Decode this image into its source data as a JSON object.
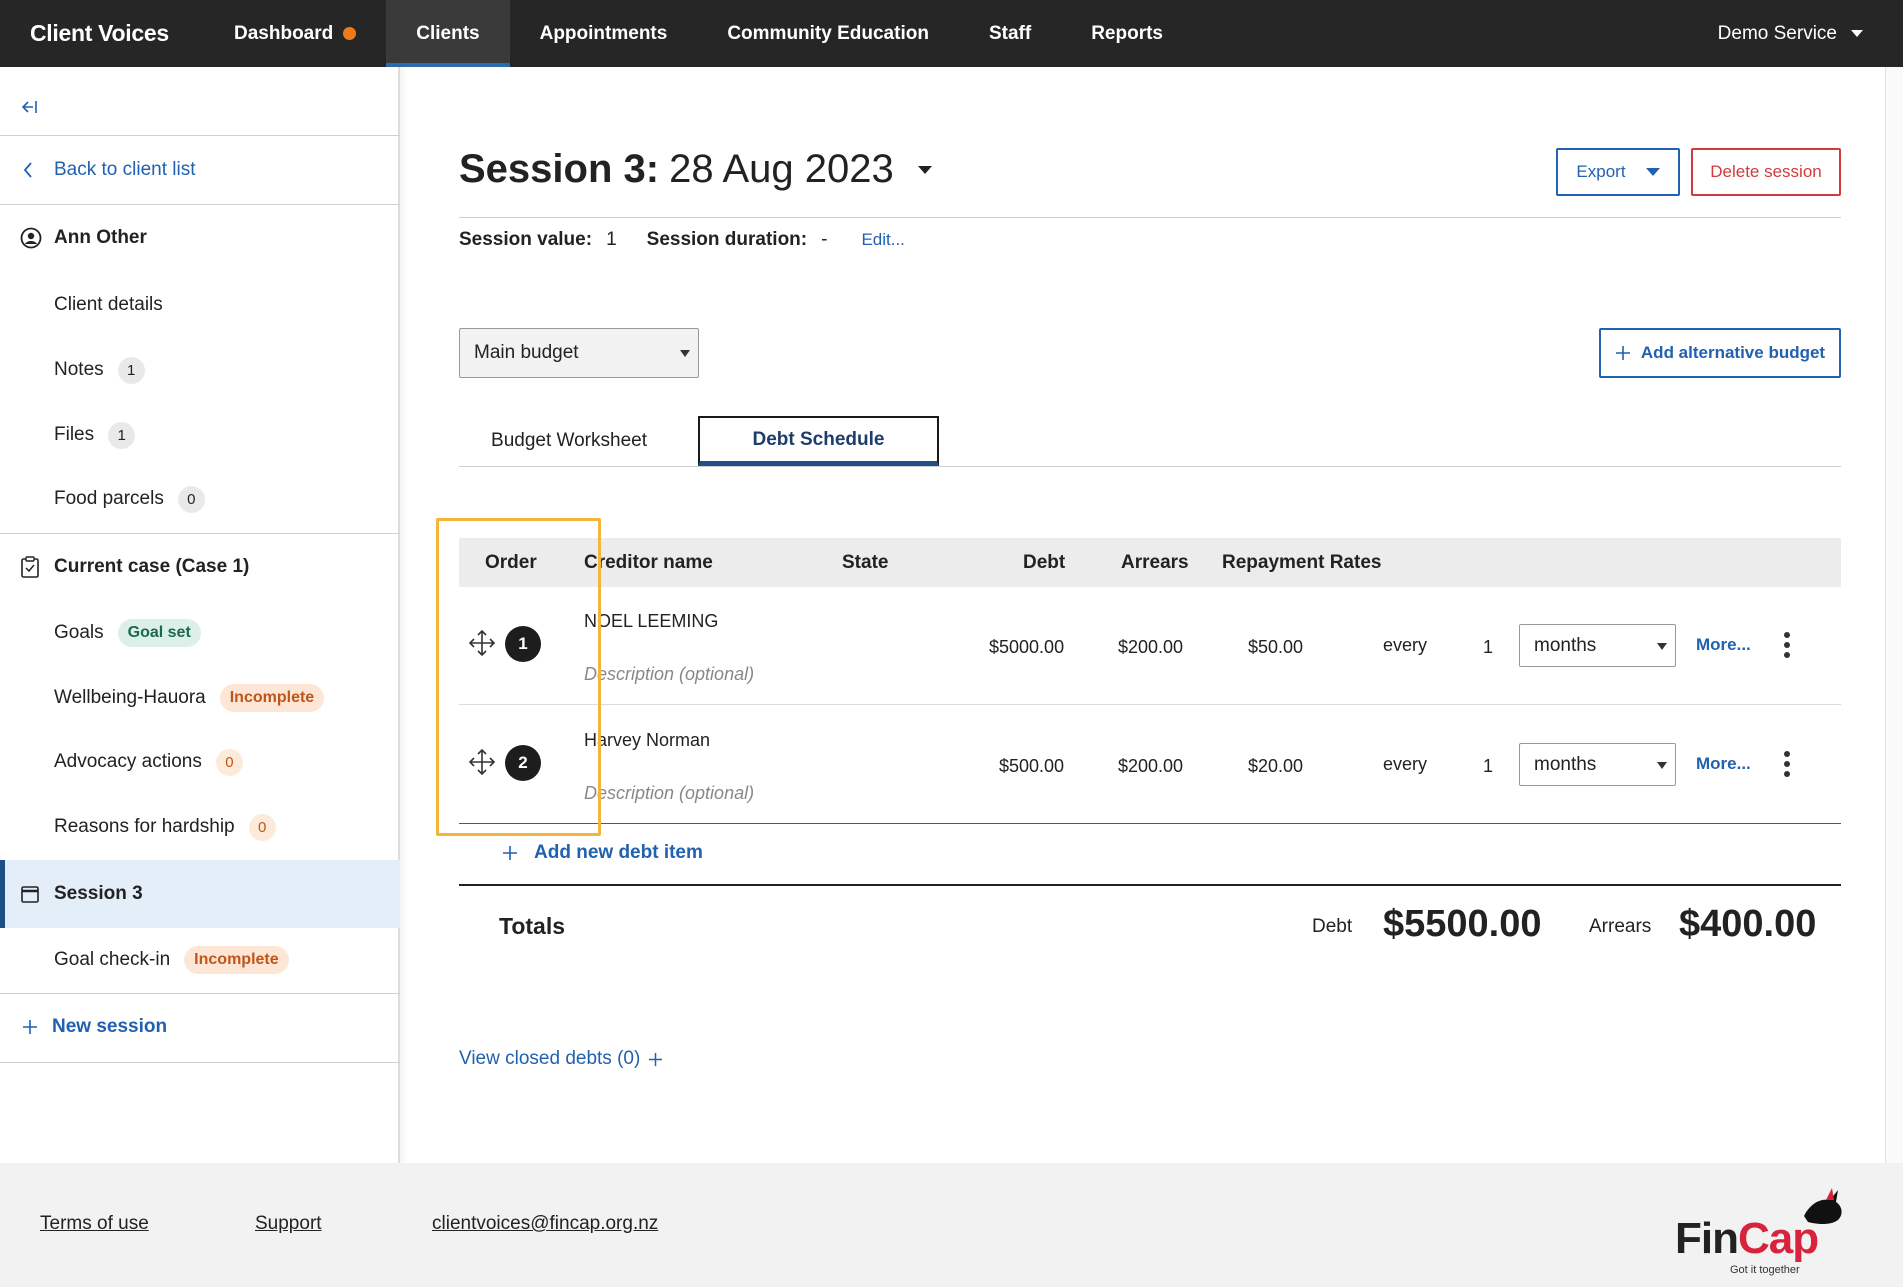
{
  "app": {
    "brand": "Client Voices"
  },
  "nav": {
    "dashboard": "Dashboard",
    "clients": "Clients",
    "appointments": "Appointments",
    "community_education": "Community Education",
    "staff": "Staff",
    "reports": "Reports",
    "service": "Demo Service"
  },
  "sidebar": {
    "back": "Back to client list",
    "client_name": "Ann Other",
    "client_details": "Client details",
    "notes": "Notes",
    "notes_count": "1",
    "files": "Files",
    "files_count": "1",
    "food_parcels": "Food parcels",
    "food_parcels_count": "0",
    "current_case": "Current case (Case 1)",
    "goals": "Goals",
    "goals_badge": "Goal set",
    "wellbeing": "Wellbeing-Hauora",
    "wellbeing_badge": "Incomplete",
    "advocacy": "Advocacy actions",
    "advocacy_count": "0",
    "hardship": "Reasons for hardship",
    "hardship_count": "0",
    "session": "Session 3",
    "goal_checkin": "Goal check-in",
    "goal_checkin_badge": "Incomplete",
    "new_session": "New session"
  },
  "session": {
    "title_prefix": "Session 3:",
    "title_date": "28 Aug 2023",
    "export": "Export",
    "delete": "Delete session",
    "value_label": "Session value:",
    "value": "1",
    "duration_label": "Session duration:",
    "duration": "-",
    "edit": "Edit..."
  },
  "budget": {
    "selected": "Main budget",
    "add_alternative": "Add alternative budget",
    "tabs": [
      "Budget Worksheet",
      "Debt Schedule"
    ],
    "active_tab": "Debt Schedule"
  },
  "table": {
    "headers": {
      "order": "Order",
      "creditor": "Creditor name",
      "state": "State",
      "debt": "Debt",
      "arrears": "Arrears",
      "repayment": "Repayment Rates"
    },
    "rows": [
      {
        "order": "1",
        "creditor": "NOEL LEEMING",
        "description_placeholder": "Description (optional)",
        "debt": "$5000.00",
        "arrears": "$200.00",
        "rate": "$50.00",
        "every": "every",
        "qty": "1",
        "period": "months",
        "more": "More..."
      },
      {
        "order": "2",
        "creditor": "Harvey Norman",
        "description_placeholder": "Description (optional)",
        "debt": "$500.00",
        "arrears": "$200.00",
        "rate": "$20.00",
        "every": "every",
        "qty": "1",
        "period": "months",
        "more": "More..."
      }
    ],
    "add_item": "Add new debt item"
  },
  "totals": {
    "label": "Totals",
    "debt_label": "Debt",
    "debt": "$5500.00",
    "arrears_label": "Arrears",
    "arrears": "$400.00"
  },
  "closed_debts": "View closed debts (0)",
  "footer": {
    "terms": "Terms of use",
    "support": "Support",
    "email": "clientvoices@fincap.org.nz",
    "logo": "FinCap",
    "logo_tagline": "Got it together"
  },
  "colors": {
    "accent": "#2161b0",
    "danger": "#d23b3b",
    "nav_bg": "#262626",
    "highlight": "#f5b43a",
    "logo_red": "#d9223b"
  }
}
